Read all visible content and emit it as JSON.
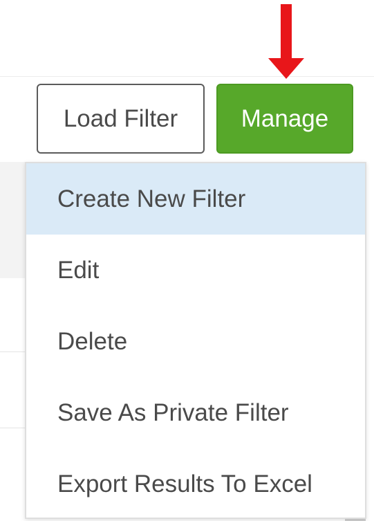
{
  "toolbar": {
    "load_filter_label": "Load Filter",
    "manage_label": "Manage"
  },
  "manage_menu": {
    "items": [
      {
        "label": "Create New Filter",
        "highlighted": true
      },
      {
        "label": "Edit",
        "highlighted": false
      },
      {
        "label": "Delete",
        "highlighted": false
      },
      {
        "label": "Save As Private Filter",
        "highlighted": false
      },
      {
        "label": "Export Results To Excel",
        "highlighted": false
      }
    ]
  },
  "annotation": {
    "icon": "arrow-down-icon",
    "color": "#e8161a"
  },
  "colors": {
    "manage_button": "#57a82a",
    "menu_highlight": "#daeaf7",
    "text": "#4a4a4a"
  }
}
